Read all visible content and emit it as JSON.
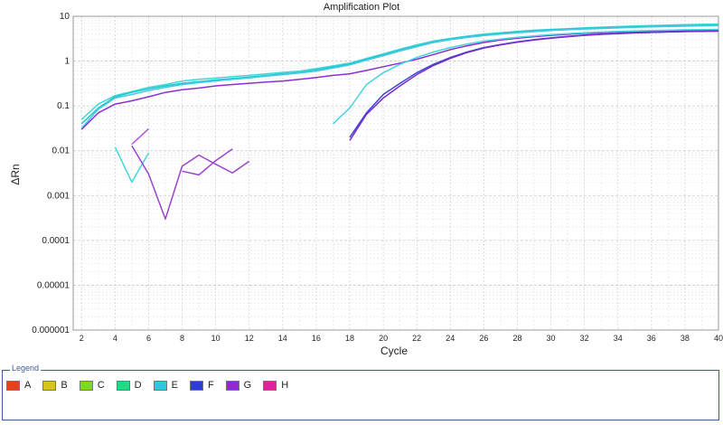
{
  "chart_data": {
    "type": "line",
    "title": "Amplification Plot",
    "xlabel": "Cycle",
    "ylabel": "ΔRn",
    "xlim": [
      1.5,
      40
    ],
    "ylim": [
      1e-06,
      10
    ],
    "yscale": "log",
    "grid": true,
    "x_ticks": [
      2,
      4,
      6,
      8,
      10,
      12,
      14,
      16,
      18,
      20,
      22,
      24,
      26,
      28,
      30,
      32,
      34,
      36,
      38,
      40
    ],
    "y_ticks": [
      {
        "value": 10,
        "label": "10"
      },
      {
        "value": 1,
        "label": "1"
      },
      {
        "value": 0.1,
        "label": "0.1"
      },
      {
        "value": 0.01,
        "label": "0.01"
      },
      {
        "value": 0.001,
        "label": "0.001"
      },
      {
        "value": 0.0001,
        "label": "0.0001"
      },
      {
        "value": 1e-05,
        "label": "0.00001"
      },
      {
        "value": 1e-06,
        "label": "0.000001"
      }
    ],
    "legend_position": "bottom",
    "legend": {
      "title": "Legend",
      "items": [
        {
          "label": "A",
          "color": "#e8401c"
        },
        {
          "label": "B",
          "color": "#d8c418"
        },
        {
          "label": "C",
          "color": "#7cdc1c"
        },
        {
          "label": "D",
          "color": "#1cdc84"
        },
        {
          "label": "E",
          "color": "#2cc8e0"
        },
        {
          "label": "F",
          "color": "#2c3cd8"
        },
        {
          "label": "G",
          "color": "#9428d8"
        },
        {
          "label": "H",
          "color": "#e020a0"
        }
      ]
    },
    "series": [
      {
        "color": "#40d8d8",
        "points": [
          [
            2,
            0.05
          ],
          [
            3,
            0.11
          ],
          [
            4,
            0.17
          ],
          [
            5,
            0.21
          ],
          [
            6,
            0.26
          ],
          [
            7,
            0.3
          ],
          [
            8,
            0.36
          ],
          [
            9,
            0.39
          ],
          [
            10,
            0.42
          ],
          [
            11,
            0.45
          ],
          [
            12,
            0.48
          ],
          [
            13,
            0.52
          ],
          [
            14,
            0.56
          ],
          [
            15,
            0.6
          ],
          [
            16,
            0.68
          ],
          [
            17,
            0.78
          ],
          [
            18,
            0.9
          ],
          [
            19,
            1.15
          ],
          [
            20,
            1.45
          ],
          [
            21,
            1.85
          ],
          [
            22,
            2.3
          ],
          [
            23,
            2.8
          ],
          [
            24,
            3.2
          ],
          [
            25,
            3.6
          ],
          [
            26,
            4.0
          ],
          [
            27,
            4.3
          ],
          [
            28,
            4.6
          ],
          [
            29,
            4.9
          ],
          [
            30,
            5.1
          ],
          [
            31,
            5.3
          ],
          [
            32,
            5.5
          ],
          [
            33,
            5.7
          ],
          [
            34,
            5.9
          ],
          [
            35,
            6.05
          ],
          [
            36,
            6.2
          ],
          [
            37,
            6.35
          ],
          [
            38,
            6.5
          ],
          [
            39,
            6.6
          ],
          [
            40,
            6.7
          ]
        ]
      },
      {
        "color": "#20c8c8",
        "points": [
          [
            2,
            0.04
          ],
          [
            3,
            0.09
          ],
          [
            4,
            0.16
          ],
          [
            5,
            0.2
          ],
          [
            6,
            0.24
          ],
          [
            7,
            0.28
          ],
          [
            8,
            0.32
          ],
          [
            9,
            0.35
          ],
          [
            10,
            0.38
          ],
          [
            11,
            0.41
          ],
          [
            12,
            0.44
          ],
          [
            13,
            0.48
          ],
          [
            14,
            0.52
          ],
          [
            15,
            0.56
          ],
          [
            16,
            0.64
          ],
          [
            17,
            0.74
          ],
          [
            18,
            0.86
          ],
          [
            19,
            1.1
          ],
          [
            20,
            1.38
          ],
          [
            21,
            1.75
          ],
          [
            22,
            2.2
          ],
          [
            23,
            2.7
          ],
          [
            24,
            3.1
          ],
          [
            25,
            3.5
          ],
          [
            26,
            3.85
          ],
          [
            27,
            4.2
          ],
          [
            28,
            4.5
          ],
          [
            29,
            4.75
          ],
          [
            30,
            5.0
          ],
          [
            31,
            5.2
          ],
          [
            32,
            5.4
          ],
          [
            33,
            5.55
          ],
          [
            34,
            5.7
          ],
          [
            35,
            5.85
          ],
          [
            36,
            6.0
          ],
          [
            37,
            6.1
          ],
          [
            38,
            6.2
          ],
          [
            39,
            6.3
          ],
          [
            40,
            6.4
          ]
        ]
      },
      {
        "color": "#48c8e8",
        "points": [
          [
            2,
            0.032
          ],
          [
            3,
            0.085
          ],
          [
            4,
            0.15
          ],
          [
            5,
            0.18
          ],
          [
            6,
            0.22
          ],
          [
            7,
            0.26
          ],
          [
            8,
            0.3
          ],
          [
            9,
            0.33
          ],
          [
            10,
            0.36
          ],
          [
            11,
            0.39
          ],
          [
            12,
            0.42
          ],
          [
            13,
            0.46
          ],
          [
            14,
            0.5
          ],
          [
            15,
            0.54
          ],
          [
            16,
            0.6
          ],
          [
            17,
            0.7
          ],
          [
            18,
            0.82
          ],
          [
            19,
            1.05
          ],
          [
            20,
            1.32
          ],
          [
            21,
            1.68
          ],
          [
            22,
            2.1
          ],
          [
            23,
            2.6
          ],
          [
            24,
            3.0
          ],
          [
            25,
            3.35
          ],
          [
            26,
            3.7
          ],
          [
            27,
            4.0
          ],
          [
            28,
            4.3
          ],
          [
            29,
            4.55
          ],
          [
            30,
            4.8
          ],
          [
            31,
            5.0
          ],
          [
            32,
            5.2
          ],
          [
            33,
            5.35
          ],
          [
            34,
            5.5
          ],
          [
            35,
            5.65
          ],
          [
            36,
            5.8
          ],
          [
            37,
            5.9
          ],
          [
            38,
            6.0
          ],
          [
            39,
            6.1
          ],
          [
            40,
            6.2
          ]
        ]
      },
      {
        "color": "#8a30d0",
        "points": [
          [
            2,
            0.03
          ],
          [
            3,
            0.07
          ],
          [
            4,
            0.11
          ],
          [
            5,
            0.13
          ],
          [
            6,
            0.16
          ],
          [
            7,
            0.2
          ],
          [
            8,
            0.23
          ],
          [
            9,
            0.25
          ],
          [
            10,
            0.28
          ],
          [
            11,
            0.3
          ],
          [
            12,
            0.32
          ],
          [
            13,
            0.34
          ],
          [
            14,
            0.36
          ],
          [
            15,
            0.39
          ],
          [
            16,
            0.43
          ],
          [
            17,
            0.48
          ],
          [
            18,
            0.52
          ],
          [
            19,
            0.62
          ],
          [
            20,
            0.75
          ],
          [
            21,
            0.9
          ],
          [
            22,
            1.1
          ],
          [
            23,
            1.4
          ],
          [
            24,
            1.8
          ],
          [
            25,
            2.2
          ],
          [
            26,
            2.6
          ],
          [
            27,
            2.95
          ],
          [
            28,
            3.25
          ],
          [
            29,
            3.5
          ],
          [
            30,
            3.75
          ],
          [
            31,
            3.95
          ],
          [
            32,
            4.15
          ],
          [
            33,
            4.3
          ],
          [
            34,
            4.45
          ],
          [
            35,
            4.55
          ],
          [
            36,
            4.65
          ],
          [
            37,
            4.75
          ],
          [
            38,
            4.82
          ],
          [
            39,
            4.9
          ],
          [
            40,
            4.95
          ]
        ]
      },
      {
        "color": "#44d4e0",
        "points": [
          [
            17,
            0.04
          ],
          [
            18,
            0.09
          ],
          [
            19,
            0.3
          ],
          [
            20,
            0.55
          ],
          [
            21,
            0.85
          ],
          [
            22,
            1.2
          ],
          [
            23,
            1.6
          ],
          [
            24,
            2.0
          ],
          [
            25,
            2.4
          ],
          [
            26,
            2.8
          ],
          [
            27,
            3.1
          ],
          [
            28,
            3.4
          ],
          [
            29,
            3.65
          ],
          [
            30,
            3.9
          ],
          [
            31,
            4.1
          ],
          [
            32,
            4.3
          ],
          [
            33,
            4.45
          ],
          [
            34,
            4.6
          ],
          [
            35,
            4.7
          ],
          [
            36,
            4.8
          ],
          [
            37,
            4.9
          ],
          [
            38,
            5.0
          ],
          [
            39,
            5.05
          ],
          [
            40,
            5.1
          ]
        ]
      },
      {
        "color": "#3a48d8",
        "points": [
          [
            18,
            0.02
          ],
          [
            19,
            0.07
          ],
          [
            20,
            0.18
          ],
          [
            21,
            0.32
          ],
          [
            22,
            0.55
          ],
          [
            23,
            0.85
          ],
          [
            24,
            1.2
          ],
          [
            25,
            1.6
          ],
          [
            26,
            2.0
          ],
          [
            27,
            2.35
          ],
          [
            28,
            2.7
          ],
          [
            29,
            3.0
          ],
          [
            30,
            3.3
          ],
          [
            31,
            3.55
          ],
          [
            32,
            3.8
          ],
          [
            33,
            4.0
          ],
          [
            34,
            4.15
          ],
          [
            35,
            4.3
          ],
          [
            36,
            4.4
          ],
          [
            37,
            4.5
          ],
          [
            38,
            4.6
          ],
          [
            39,
            4.65
          ],
          [
            40,
            4.7
          ]
        ]
      },
      {
        "color": "#7a2cc8",
        "points": [
          [
            18,
            0.017
          ],
          [
            19,
            0.065
          ],
          [
            20,
            0.15
          ],
          [
            21,
            0.28
          ],
          [
            22,
            0.5
          ],
          [
            23,
            0.8
          ],
          [
            24,
            1.15
          ],
          [
            25,
            1.55
          ],
          [
            26,
            1.95
          ],
          [
            27,
            2.3
          ],
          [
            28,
            2.65
          ],
          [
            29,
            2.95
          ],
          [
            30,
            3.25
          ],
          [
            31,
            3.5
          ],
          [
            32,
            3.75
          ],
          [
            33,
            3.95
          ],
          [
            34,
            4.1
          ],
          [
            35,
            4.25
          ],
          [
            36,
            4.35
          ],
          [
            37,
            4.45
          ],
          [
            38,
            4.55
          ],
          [
            39,
            4.6
          ],
          [
            40,
            4.65
          ]
        ]
      },
      {
        "color": "#40d8d8",
        "points": [
          [
            4,
            0.012
          ],
          [
            5,
            0.002
          ],
          [
            6,
            0.009
          ]
        ]
      },
      {
        "color": "#9a44d0",
        "points": [
          [
            5,
            0.013
          ],
          [
            6,
            0.003
          ],
          [
            7,
            0.0003
          ],
          [
            8,
            0.0045
          ],
          [
            9,
            0.008
          ],
          [
            10,
            0.005
          ],
          [
            11,
            0.0032
          ],
          [
            12,
            0.0058
          ]
        ]
      },
      {
        "color": "#b050d8",
        "points": [
          [
            5,
            0.014
          ],
          [
            6,
            0.031
          ]
        ]
      },
      {
        "color": "#9a44d0",
        "points": [
          [
            8,
            0.0035
          ],
          [
            9,
            0.0029
          ],
          [
            10,
            0.006
          ],
          [
            11,
            0.011
          ]
        ]
      }
    ]
  }
}
